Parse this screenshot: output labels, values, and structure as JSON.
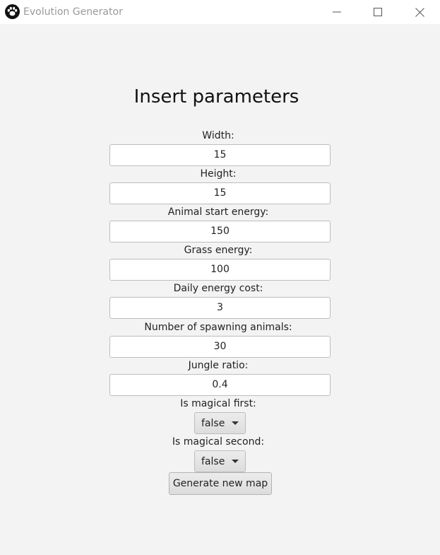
{
  "window": {
    "title": "Evolution Generator",
    "icon": "paw-icon",
    "controls": [
      "minimize-icon",
      "maximize-icon",
      "close-icon"
    ]
  },
  "form": {
    "heading": "Insert parameters",
    "fields": [
      {
        "label": "Width:",
        "value": "15"
      },
      {
        "label": "Height:",
        "value": "15"
      },
      {
        "label": "Animal start energy:",
        "value": "150"
      },
      {
        "label": "Grass energy:",
        "value": "100"
      },
      {
        "label": "Daily energy cost:",
        "value": "3"
      },
      {
        "label": "Number of spawning animals:",
        "value": "30"
      },
      {
        "label": "Jungle ratio:",
        "value": "0.4"
      }
    ],
    "selects": [
      {
        "label": "Is magical first:",
        "value": "false"
      },
      {
        "label": "Is magical second:",
        "value": "false"
      }
    ],
    "submit_label": "Generate new map"
  }
}
